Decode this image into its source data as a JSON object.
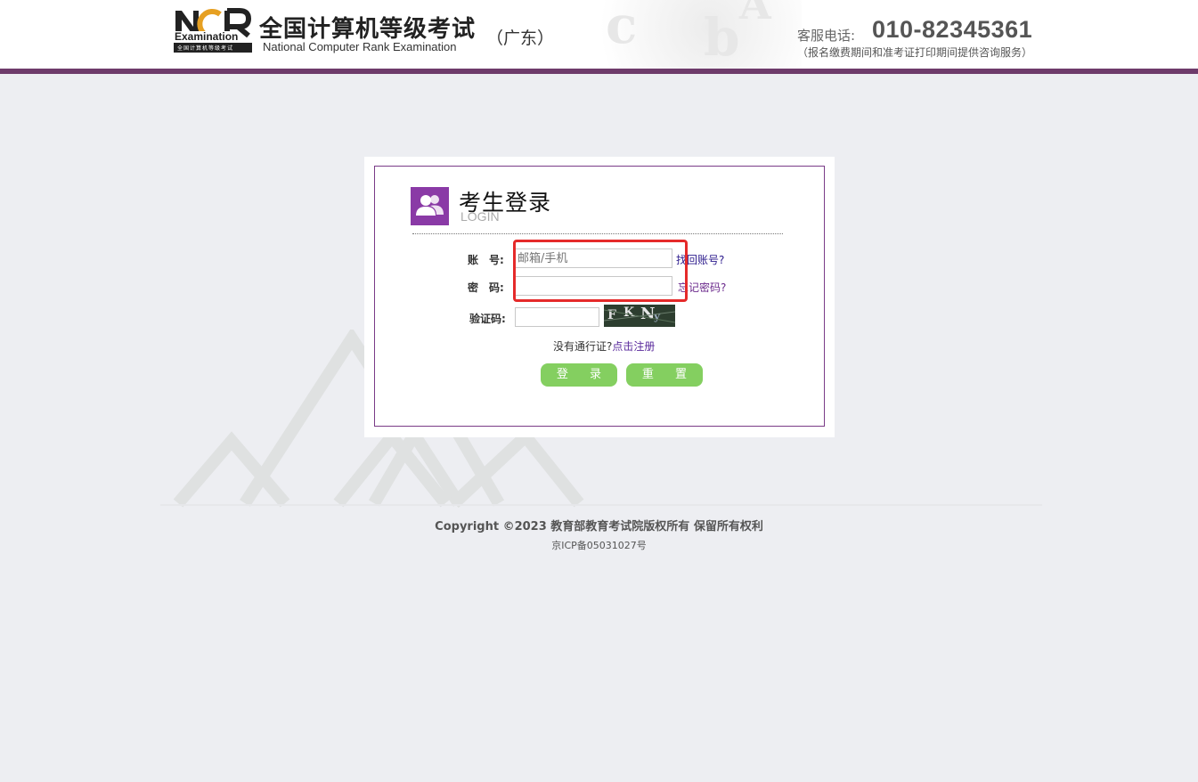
{
  "header": {
    "logo_text": "NCR",
    "logo_sub": "Examination",
    "logo_caption": "全国计算机等级考试",
    "brand_cn": "全国计算机等级考试",
    "brand_en": "National Computer Rank Examination",
    "region": "（广东）",
    "hotline_label": "客服电话:",
    "hotline_number": "010-82345361",
    "hotline_note": "（报名缴费期间和准考证打印期间提供咨询服务）"
  },
  "login": {
    "title": "考生登录",
    "subtitle": "LOGIN",
    "account_label": "账　号:",
    "account_placeholder": "邮箱/手机",
    "account_value": "",
    "find_account": "找回账号?",
    "password_label": "密　码:",
    "password_placeholder": "",
    "forgot_password": "忘记密码?",
    "captcha_label": "验证码:",
    "captcha_value": "",
    "captcha_text": [
      "F",
      "K",
      "N",
      "y"
    ],
    "no_pass_text": "没有通行证?",
    "register_link": "点击注册",
    "login_button": "登 录",
    "reset_button": "重 置"
  },
  "footer": {
    "copyright": "Copyright ©2023 教育部教育考试院版权所有 保留所有权利",
    "icp": "京ICP备05031027号"
  },
  "colors": {
    "accent_purple": "#8a3aa6",
    "header_bar": "#6e3b6b",
    "button_green": "#84cf60",
    "highlight_red": "#e52a2a",
    "page_bg": "#edeef2"
  }
}
